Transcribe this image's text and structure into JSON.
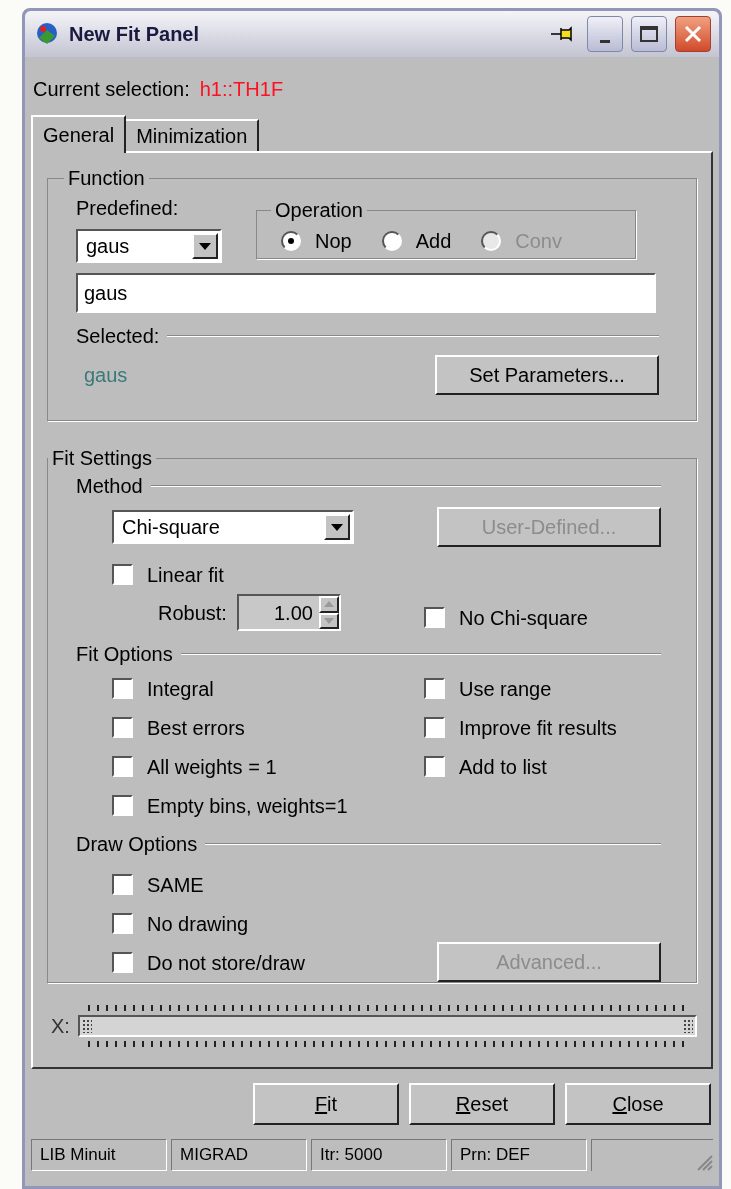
{
  "window": {
    "title": "New Fit Panel"
  },
  "current_selection": {
    "label": "Current selection:",
    "value": "h1::TH1F"
  },
  "tabs": [
    {
      "label": "General",
      "selected": true
    },
    {
      "label": "Minimization",
      "selected": false
    }
  ],
  "function": {
    "title": "Function",
    "predefined_label": "Predefined:",
    "predefined_value": "gaus",
    "operation": {
      "title": "Operation",
      "options": [
        {
          "label": "Nop",
          "selected": true,
          "disabled": false
        },
        {
          "label": "Add",
          "selected": false,
          "disabled": false
        },
        {
          "label": "Conv",
          "selected": false,
          "disabled": true
        }
      ]
    },
    "formula": "gaus",
    "selected_label": "Selected:",
    "selected_value": "gaus",
    "set_parameters_button": "Set Parameters..."
  },
  "fit_settings": {
    "title": "Fit Settings",
    "method": {
      "title": "Method",
      "value": "Chi-square",
      "user_defined_button": {
        "label": "User-Defined...",
        "disabled": true
      },
      "linear_fit": {
        "label": "Linear fit",
        "checked": false
      },
      "robust_label": "Robust:",
      "robust_value": "1.00",
      "no_chi_square": {
        "label": "No Chi-square",
        "checked": false
      }
    },
    "fit_options": {
      "title": "Fit Options",
      "left": [
        {
          "label": "Integral",
          "checked": false
        },
        {
          "label": "Best errors",
          "checked": false
        },
        {
          "label": "All weights = 1",
          "checked": false
        },
        {
          "label": "Empty bins, weights=1",
          "checked": false
        }
      ],
      "right": [
        {
          "label": "Use range",
          "checked": false
        },
        {
          "label": "Improve fit results",
          "checked": false
        },
        {
          "label": "Add to list",
          "checked": false
        }
      ]
    },
    "draw_options": {
      "title": "Draw Options",
      "items": [
        {
          "label": "SAME",
          "checked": false
        },
        {
          "label": "No drawing",
          "checked": false
        },
        {
          "label": "Do not store/draw",
          "checked": false
        }
      ],
      "advanced_button": {
        "label": "Advanced...",
        "disabled": true
      }
    }
  },
  "range": {
    "label": "X:",
    "level": 1
  },
  "buttons": [
    "Fit",
    "Reset",
    "Close"
  ],
  "status_bar": [
    "LIB Minuit",
    "MIGRAD",
    "Itr: 5000",
    "Prn: DEF"
  ]
}
